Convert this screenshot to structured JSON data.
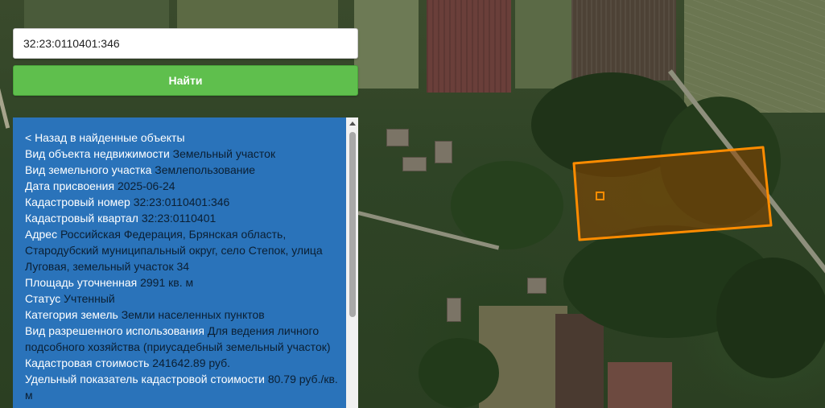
{
  "search": {
    "value": "32:23:0110401:346",
    "button_label": "Найти"
  },
  "info": {
    "back_label": "< Назад в найденные объекты",
    "rows": [
      {
        "key": "Вид объекта недвижимости",
        "value": "Земельный участок"
      },
      {
        "key": "Вид земельного участка",
        "value": "Землепользование"
      },
      {
        "key": "Дата присвоения",
        "value": "2025-06-24"
      },
      {
        "key": "Кадастровый номер",
        "value": "32:23:0110401:346"
      },
      {
        "key": "Кадастровый квартал",
        "value": "32:23:0110401"
      },
      {
        "key": "Адрес",
        "value": "Российская Федерация, Брянская область, Стародубский муниципальный округ, село Степок, улица Луговая, земельный участок 34"
      },
      {
        "key": "Площадь уточненная",
        "value": "2991 кв. м"
      },
      {
        "key": "Статус",
        "value": "Учтенный"
      },
      {
        "key": "Категория земель",
        "value": "Земли населенных пунктов"
      },
      {
        "key": "Вид разрешенного использования",
        "value": "Для ведения личного подсобного хозяйства (приусадебный земельный участок)"
      },
      {
        "key": "Кадастровая стоимость",
        "value": "241642.89 руб."
      },
      {
        "key": "Удельный показатель кадастровой стоимости",
        "value": "80.79 руб./кв. м"
      }
    ]
  },
  "colors": {
    "panel_bg": "#2a73ba",
    "button_bg": "#5fbf4d",
    "parcel_stroke": "#ff8c00"
  }
}
